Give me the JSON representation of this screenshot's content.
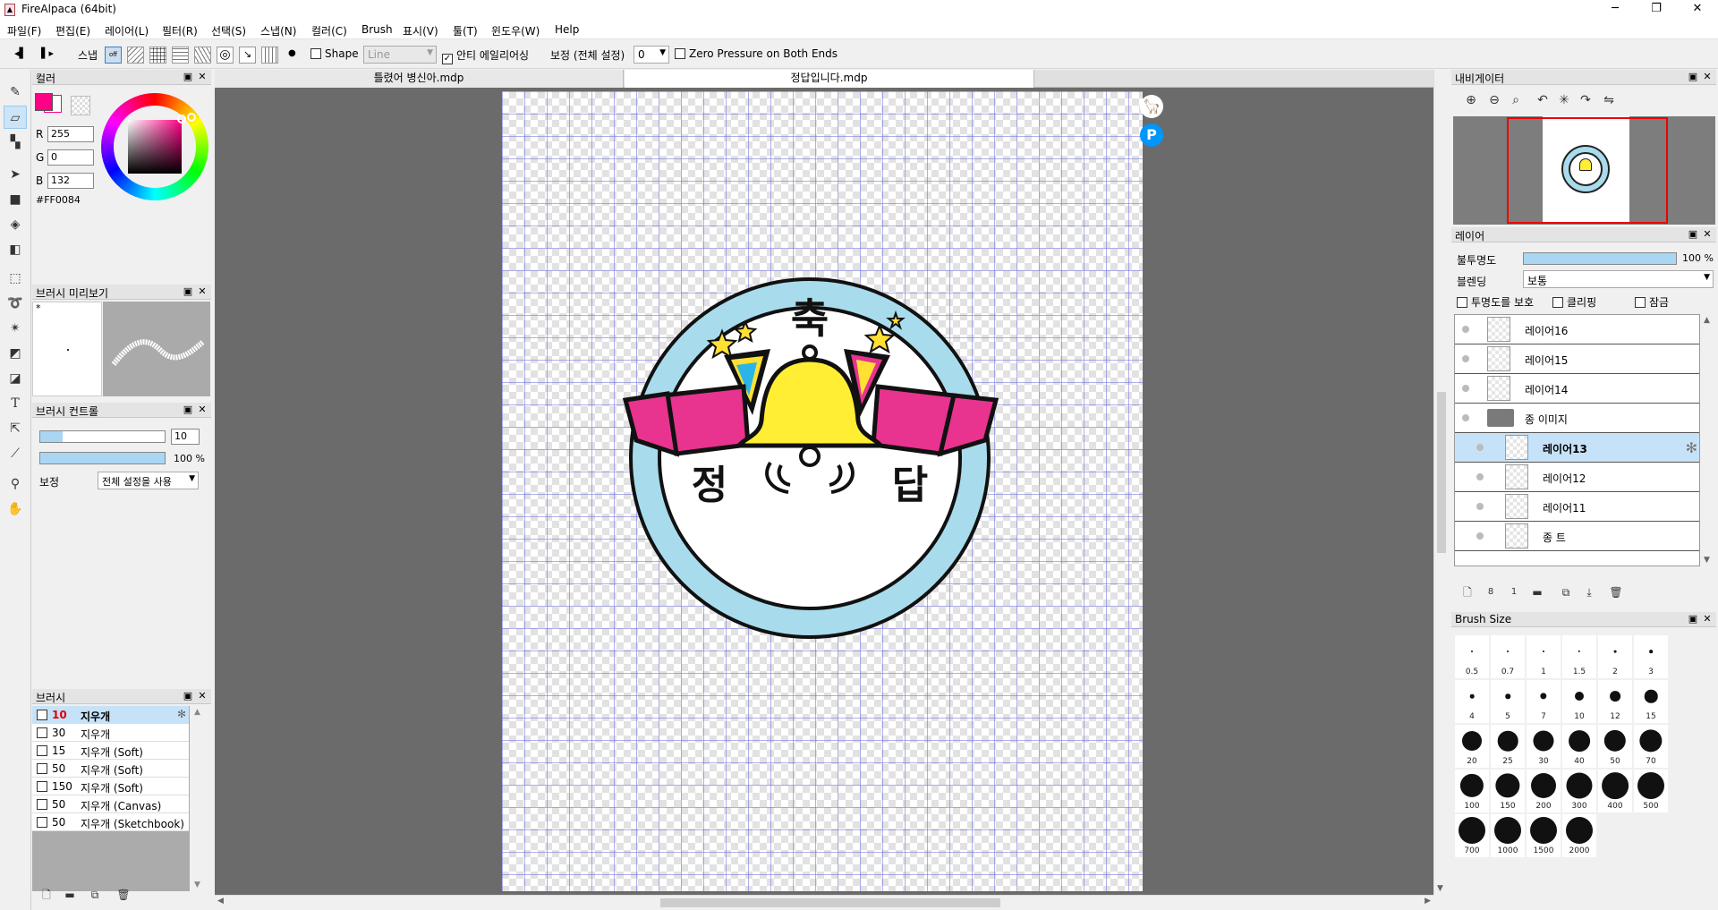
{
  "window": {
    "title": "FireAlpaca (64bit)",
    "minimize": "─",
    "maximize": "❐",
    "close": "✕"
  },
  "menu": [
    "파일(F)",
    "편집(E)",
    "레이어(L)",
    "필터(R)",
    "선택(S)",
    "스냅(N)",
    "컬러(C)",
    "Brush",
    "표시(V)",
    "툴(T)",
    "윈도우(W)",
    "Help"
  ],
  "toolbar": {
    "snap_label": "스냅",
    "shape_label": "Shape",
    "shape_value": "Line",
    "antialias_label": "안티 에일리어싱",
    "antialias_checked": true,
    "correction_label": "보정 (전체 설정)",
    "correction_value": "0",
    "zero_pressure_label": "Zero Pressure on Both Ends"
  },
  "color_panel": {
    "title": "컬러",
    "r_label": "R",
    "r_value": "255",
    "g_label": "G",
    "g_value": "0",
    "b_label": "B",
    "b_value": "132",
    "hex": "#FF0084",
    "primary_color": "#ff0084"
  },
  "brush_preview": {
    "title": "브러시 미리보기",
    "marker": "*"
  },
  "brush_control": {
    "title": "브러시 컨트롤",
    "size_value": "10",
    "opacity_value": "100 %",
    "correction_label": "보정",
    "correction_value": "전체 설정을 사용"
  },
  "brush_list": {
    "title": "브러시",
    "items": [
      {
        "size": "10",
        "name": "지우개",
        "selected": true
      },
      {
        "size": "30",
        "name": "지우개"
      },
      {
        "size": "15",
        "name": "지우개 (Soft)"
      },
      {
        "size": "50",
        "name": "지우개 (Soft)"
      },
      {
        "size": "150",
        "name": "지우개 (Soft)"
      },
      {
        "size": "50",
        "name": "지우개 (Canvas)"
      },
      {
        "size": "50",
        "name": "지우개 (Sketchbook)"
      }
    ]
  },
  "doc_tabs": [
    {
      "label": "틀렸어 병신아.mdp",
      "active": false
    },
    {
      "label": "정답입니다.mdp",
      "active": true
    }
  ],
  "artwork": {
    "top_text": "축",
    "bottom_left": "정",
    "bottom_right": "답",
    "ring_color": "#a8dcec",
    "bell_color": "#ffee33",
    "ribbon_color": "#e8338f"
  },
  "canvas_badges": {
    "alpaca": "🦙",
    "pixiv": "P"
  },
  "navigator": {
    "title": "내비게이터"
  },
  "layer_panel": {
    "title": "레이어",
    "opacity_label": "불투명도",
    "opacity_value": "100 %",
    "opacity_fraction": 1.0,
    "blend_label": "블렌딩",
    "blend_value": "보통",
    "protect_label": "투명도를 보호",
    "clipping_label": "클리핑",
    "lock_label": "잠금",
    "layers": [
      {
        "name": "레이어16",
        "indent": false,
        "selected": false,
        "folder": false
      },
      {
        "name": "레이어15",
        "indent": false,
        "selected": false,
        "folder": false
      },
      {
        "name": "레이어14",
        "indent": false,
        "selected": false,
        "folder": false
      },
      {
        "name": "종 이미지",
        "indent": false,
        "selected": false,
        "folder": true
      },
      {
        "name": "레이어13",
        "indent": true,
        "selected": true,
        "folder": false
      },
      {
        "name": "레이어12",
        "indent": true,
        "selected": false,
        "folder": false
      },
      {
        "name": "레이어11",
        "indent": true,
        "selected": false,
        "folder": false
      },
      {
        "name": "종 트",
        "indent": true,
        "selected": false,
        "folder": false
      }
    ]
  },
  "brush_size_panel": {
    "title": "Brush Size",
    "sizes": [
      "0.5",
      "0.7",
      "1",
      "1.5",
      "2",
      "3",
      "4",
      "5",
      "7",
      "10",
      "12",
      "15",
      "20",
      "25",
      "30",
      "40",
      "50",
      "70",
      "100",
      "150",
      "200",
      "300",
      "400",
      "500",
      "700",
      "1000",
      "1500",
      "2000"
    ]
  }
}
